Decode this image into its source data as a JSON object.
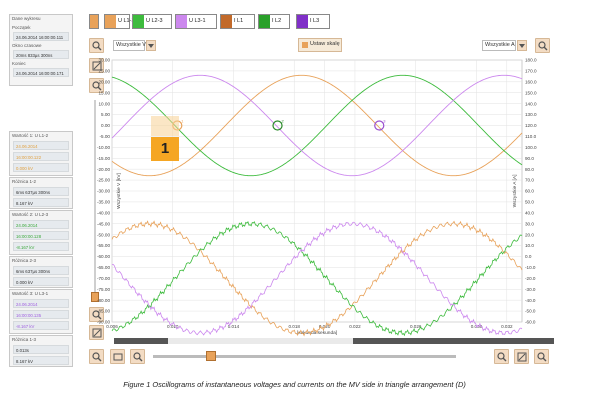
{
  "info_panel": {
    "title": "Dane wykresu",
    "start_label": "Początek",
    "start_value": "24.06.2014 16:00:00.111",
    "window_label": "Okno czasowe",
    "window_value": "20ms 833µs 300ns",
    "end_label": "Koniec",
    "end_value": "24.06.2014 16:00:00.171"
  },
  "cursor_panels": [
    {
      "title": "Wartość 1: U L1-2",
      "date": "24.06.2014",
      "time": "16:00:00.122",
      "value": "0.000 kV",
      "color": "#e0a040"
    },
    {
      "title": "Różnica 1-2",
      "date": "",
      "time": "6ms 637µs 300ns",
      "value": "8.167 kV",
      "color": "#555555"
    },
    {
      "title": "Wartość 2: U L2-3",
      "date": "24.06.2014",
      "time": "16:00:00.128",
      "value": "-8.167 kV",
      "color": "#3aa83a"
    },
    {
      "title": "Różnica 2-3",
      "date": "",
      "time": "6ms 637µs 300ns",
      "value": "0.000 kV",
      "color": "#555555"
    },
    {
      "title": "Wartość 3: U L3-1",
      "date": "24.06.2014",
      "time": "16:00:00.135",
      "value": "-8.167 kV",
      "color": "#a060e0"
    },
    {
      "title": "Różnica 1-3",
      "date": "",
      "time": "0.013s",
      "value": "8.167 kV",
      "color": "#555555"
    }
  ],
  "channels": [
    {
      "label": "U L1-2",
      "color": "#e8a25a"
    },
    {
      "label": "U L2-3",
      "color": "#3dbb3d"
    },
    {
      "label": "U L3-1",
      "color": "#cc88ee"
    },
    {
      "label": "I L1",
      "color": "#c26a2a"
    },
    {
      "label": "I L2",
      "color": "#2aa02a"
    },
    {
      "label": "I L3",
      "color": "#8030c8"
    }
  ],
  "toolbar": {
    "left_select": "Wszystkie V",
    "set_scale_label": "Ustaw skalę",
    "right_select": "Wszystkie A"
  },
  "marker": {
    "label": "1"
  },
  "caption": "Figure 1 Oscillograms of instantaneous voltages and currents on the MV side in triangle arrangement (D)",
  "chart_data": {
    "type": "line",
    "xlabel": "[sekunda:sekunda]",
    "ylabel_left": "Wszystkie V [kV]",
    "ylabel_right": "Wszystkie A [A]",
    "xlim": [
      0.006,
      0.033
    ],
    "ylim_left": [
      -90,
      30
    ],
    "ylim_right": [
      -60,
      180
    ],
    "x_ticks": [
      "0.006",
      "0.010",
      "0.014",
      "0.018",
      "0.020",
      "0.022",
      "0.026",
      "0.030",
      "0.032"
    ],
    "y_ticks_left": [
      "30.00",
      "25.00",
      "20.00",
      "15.00",
      "10.00",
      "5.00",
      "0.00",
      "-5.00",
      "-10.00",
      "-15.00",
      "-20.00",
      "-25.00",
      "-30.00",
      "-35.00",
      "-40.00",
      "-45.00",
      "-50.00",
      "-55.00",
      "-60.00",
      "-65.00",
      "-70.00",
      "-75.00",
      "-80.00",
      "-85.00",
      "-90.00"
    ],
    "y_ticks_right": [
      "180.0",
      "170.0",
      "160.0",
      "150.0",
      "140.0",
      "130.0",
      "120.0",
      "110.0",
      "100.0",
      "90.0",
      "80.0",
      "70.0",
      "60.0",
      "50.0",
      "40.0",
      "30.0",
      "20.0",
      "10.0",
      "0.0",
      "-10.0",
      "-20.0",
      "-30.0",
      "-40.0",
      "-50.0",
      "-60.0"
    ],
    "grid": true,
    "voltage_series": [
      {
        "name": "U L1-2",
        "color": "#e8a25a",
        "amplitude_kv": 23,
        "phase_deg": 0
      },
      {
        "name": "U L2-3",
        "color": "#3dbb3d",
        "amplitude_kv": 23,
        "phase_deg": -120
      },
      {
        "name": "U L3-1",
        "color": "#cc88ee",
        "amplitude_kv": 23,
        "phase_deg": 120
      }
    ],
    "current_series": [
      {
        "name": "I L1",
        "color": "#e8a25a",
        "offset_a": -20,
        "amplitude_a": 50,
        "phase_deg": 180
      },
      {
        "name": "I L2",
        "color": "#3dbb3d",
        "offset_a": -20,
        "amplitude_a": 50,
        "phase_deg": 60
      },
      {
        "name": "I L3",
        "color": "#cc88ee",
        "offset_a": -20,
        "amplitude_a": 50,
        "phase_deg": -60
      }
    ],
    "frequency_hz": 50,
    "cursors": [
      {
        "x": 0.0103,
        "y_kv": 0,
        "color": "#e8a25a"
      },
      {
        "x": 0.0169,
        "y_kv": 0,
        "color": "#2a8a2a"
      },
      {
        "x": 0.0236,
        "y_kv": 0,
        "color": "#9a50d0"
      }
    ]
  }
}
